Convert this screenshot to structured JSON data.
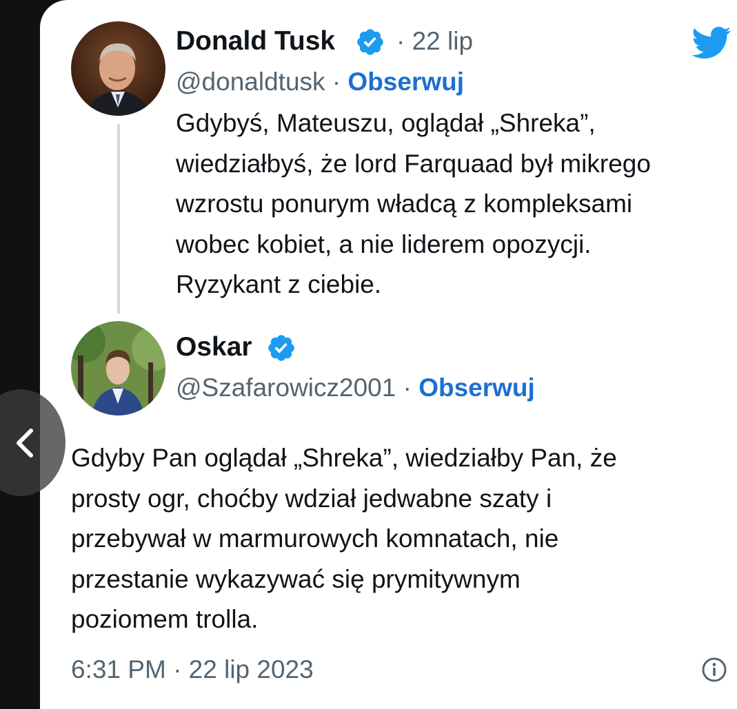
{
  "original_tweet": {
    "name": "Donald Tusk",
    "date_sep": "·",
    "date": "22 lip",
    "handle": "@donaldtusk",
    "handle_sep": "·",
    "follow_label": "Obserwuj",
    "text_lines": [
      "Gdybyś, Mateuszu, oglądał „Shreka”,",
      "wiedziałbyś, że lord Farquaad był mikrego",
      "wzrostu ponurym władcą z kompleksami",
      "wobec kobiet, a nie liderem opozycji.",
      "Ryzykant z ciebie."
    ]
  },
  "reply_tweet": {
    "name": "Oskar",
    "handle": "@Szafarowicz2001",
    "handle_sep": "·",
    "follow_label": "Obserwuj",
    "text_lines": [
      "Gdyby Pan oglądał „Shreka”, wiedziałby Pan, że",
      "prosty ogr, choćby wdział jedwabne szaty i",
      "przebywał w marmurowych komnatach, nie",
      "przestanie wykazywać się prymitywnym",
      "poziomem trolla."
    ],
    "timestamp": "6:31 PM · 22 lip 2023"
  },
  "icons": {
    "brand": "twitter-bird-icon",
    "verified": "verified-badge-icon",
    "back": "chevron-left-icon",
    "info": "info-icon"
  },
  "colors": {
    "twitter_blue": "#1d9bf0",
    "follow_blue": "#1d6fd0",
    "text": "#0f1419",
    "secondary": "#536471"
  }
}
